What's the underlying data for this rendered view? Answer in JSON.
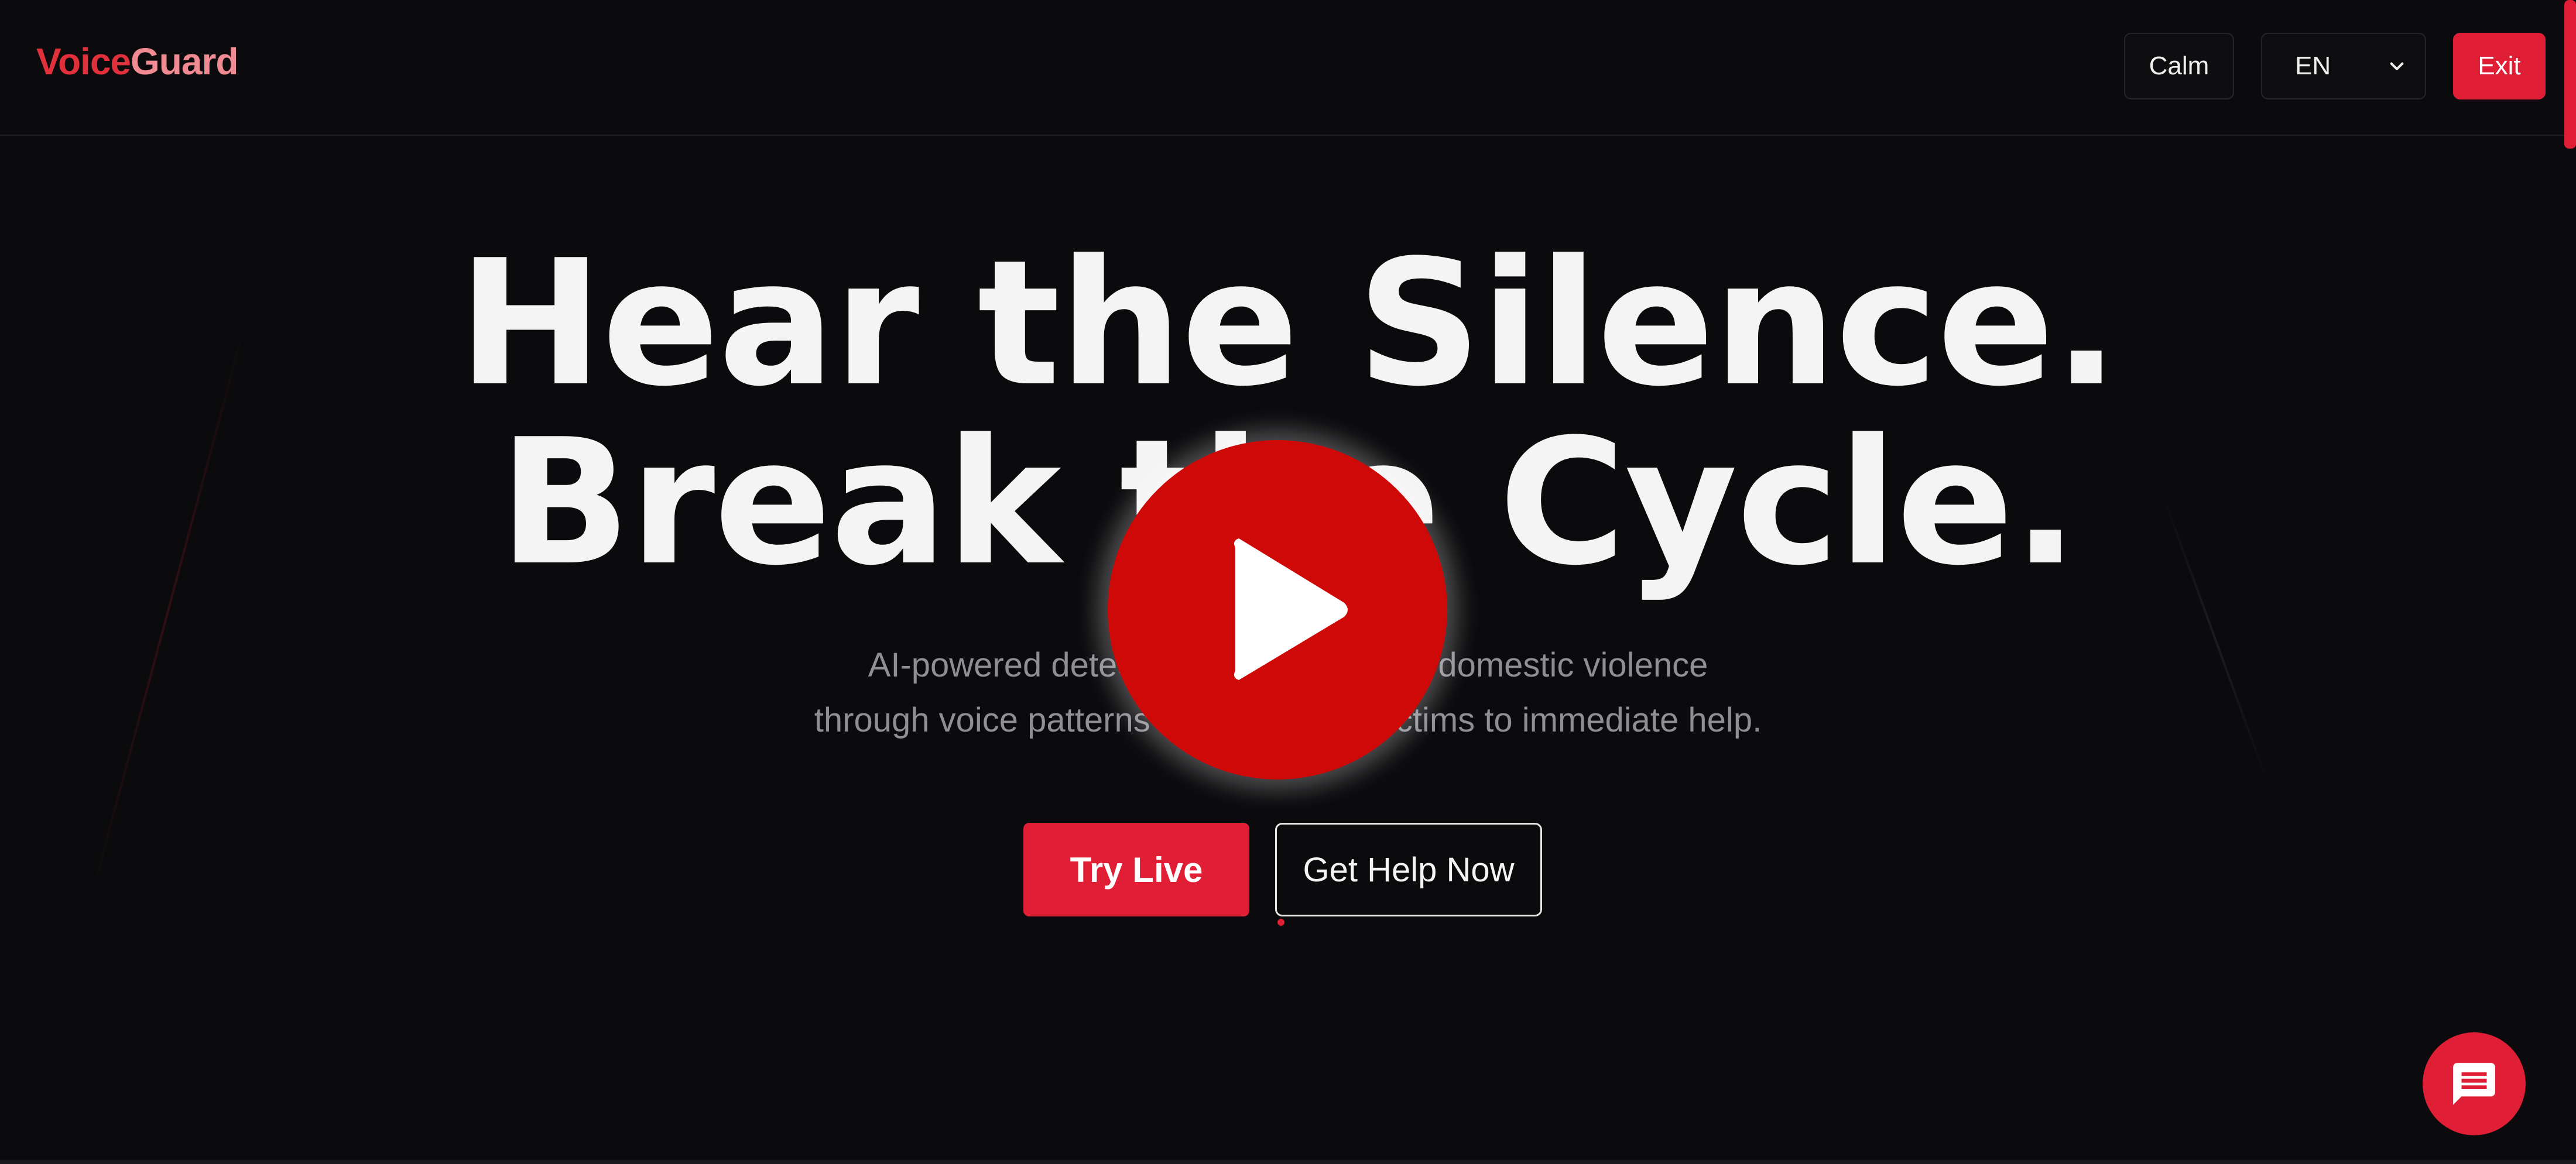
{
  "brand": {
    "name_part1": "Voice",
    "name_part2": "Guard",
    "accent_color": "#e01e35",
    "secondary_color": "#f08a93"
  },
  "header": {
    "calm_label": "Calm",
    "language": {
      "selected": "EN",
      "icon": "chevron-down-icon"
    },
    "exit_label": "Exit"
  },
  "hero": {
    "title_line1": "Hear the Silence.",
    "title_line2": "Break the Cycle.",
    "subtitle_line1": "AI-powered detection that recognizes domestic violence",
    "subtitle_line2": "through voice patterns and connects victims to immediate help.",
    "primary_cta": "Try Live",
    "secondary_cta": "Get Help Now"
  },
  "overlay": {
    "icon": "play-icon",
    "color": "#cf0808"
  },
  "chat": {
    "icon": "chat-icon"
  },
  "colors": {
    "background": "#0b0b0d",
    "text": "#f4f4f4",
    "muted_text": "#8e8e93"
  }
}
